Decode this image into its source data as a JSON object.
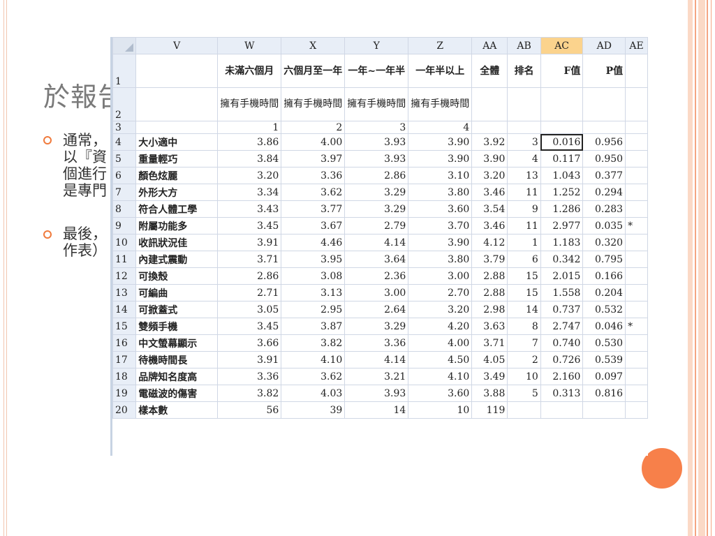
{
  "slide": {
    "title": "於報告",
    "bullets": [
      {
        "lines": [
          "通常，",
          "以『資",
          "個進行",
          "是專門"
        ]
      },
      {
        "lines": [
          "最後，",
          "作表）"
        ]
      }
    ]
  },
  "sheet": {
    "columns": [
      "V",
      "W",
      "X",
      "Y",
      "Z",
      "AA",
      "AB",
      "AC",
      "AD",
      "AE"
    ],
    "selected_column": "AC",
    "header_row1": [
      "",
      "未滿六個月",
      "六個月至一年",
      "一年~一年半",
      "一年半以上",
      "全體",
      "排名",
      "F值",
      "P值",
      ""
    ],
    "header_row2": [
      "",
      "擁有手機時間",
      "擁有手機時間",
      "擁有手機時間",
      "擁有手機時間",
      "",
      "",
      "",
      "",
      ""
    ],
    "header_row3": [
      "",
      "1",
      "2",
      "3",
      "4",
      "",
      "",
      "",
      "",
      ""
    ],
    "rows": [
      {
        "num": "4",
        "cells": [
          "大小適中",
          "3.86",
          "4.00",
          "3.93",
          "3.90",
          "3.92",
          "3",
          "0.016",
          "0.956",
          ""
        ]
      },
      {
        "num": "5",
        "cells": [
          "重量輕巧",
          "3.84",
          "3.97",
          "3.93",
          "3.90",
          "3.90",
          "4",
          "0.117",
          "0.950",
          ""
        ]
      },
      {
        "num": "6",
        "cells": [
          "顏色炫麗",
          "3.20",
          "3.36",
          "2.86",
          "3.10",
          "3.20",
          "13",
          "1.043",
          "0.377",
          ""
        ]
      },
      {
        "num": "7",
        "cells": [
          "外形大方",
          "3.34",
          "3.62",
          "3.29",
          "3.80",
          "3.46",
          "11",
          "1.252",
          "0.294",
          ""
        ]
      },
      {
        "num": "8",
        "cells": [
          "符合人體工學",
          "3.43",
          "3.77",
          "3.29",
          "3.60",
          "3.54",
          "9",
          "1.286",
          "0.283",
          ""
        ]
      },
      {
        "num": "9",
        "cells": [
          "附屬功能多",
          "3.45",
          "3.67",
          "2.79",
          "3.70",
          "3.46",
          "11",
          "2.977",
          "0.035",
          "*"
        ]
      },
      {
        "num": "10",
        "cells": [
          "收訊狀況佳",
          "3.91",
          "4.46",
          "4.14",
          "3.90",
          "4.12",
          "1",
          "1.183",
          "0.320",
          ""
        ]
      },
      {
        "num": "11",
        "cells": [
          "內建式震動",
          "3.71",
          "3.95",
          "3.64",
          "3.80",
          "3.79",
          "6",
          "0.342",
          "0.795",
          ""
        ]
      },
      {
        "num": "12",
        "cells": [
          "可換殼",
          "2.86",
          "3.08",
          "2.36",
          "3.00",
          "2.88",
          "15",
          "2.015",
          "0.166",
          ""
        ]
      },
      {
        "num": "13",
        "cells": [
          "可編曲",
          "2.71",
          "3.13",
          "3.00",
          "2.70",
          "2.88",
          "15",
          "1.558",
          "0.204",
          ""
        ]
      },
      {
        "num": "14",
        "cells": [
          "可掀蓋式",
          "3.05",
          "2.95",
          "2.64",
          "3.20",
          "2.98",
          "14",
          "0.737",
          "0.532",
          ""
        ]
      },
      {
        "num": "15",
        "cells": [
          "雙頻手機",
          "3.45",
          "3.87",
          "3.29",
          "4.20",
          "3.63",
          "8",
          "2.747",
          "0.046",
          "*"
        ]
      },
      {
        "num": "16",
        "cells": [
          "中文螢幕顯示",
          "3.66",
          "3.82",
          "3.36",
          "4.00",
          "3.71",
          "7",
          "0.740",
          "0.530",
          ""
        ]
      },
      {
        "num": "17",
        "cells": [
          "待機時間長",
          "3.91",
          "4.10",
          "4.14",
          "4.50",
          "4.05",
          "2",
          "0.726",
          "0.539",
          ""
        ]
      },
      {
        "num": "18",
        "cells": [
          "品牌知名度高",
          "3.36",
          "3.62",
          "3.21",
          "4.10",
          "3.49",
          "10",
          "2.160",
          "0.097",
          ""
        ]
      },
      {
        "num": "19",
        "cells": [
          "電磁波的傷害",
          "3.82",
          "4.03",
          "3.93",
          "3.60",
          "3.88",
          "5",
          "0.313",
          "0.816",
          ""
        ]
      },
      {
        "num": "20",
        "cells": [
          "樣本數",
          "56",
          "39",
          "14",
          "10",
          "119",
          "",
          "",
          "",
          ""
        ]
      }
    ]
  },
  "colors": {
    "accent": "#f7804a",
    "header_bg": "#e8eef7",
    "selected_header": "#fbd38d"
  }
}
